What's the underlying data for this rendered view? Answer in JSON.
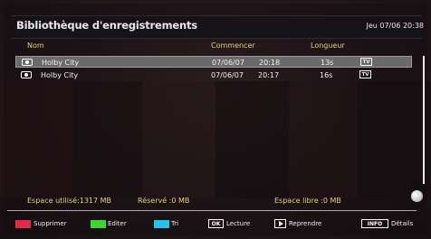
{
  "header": {
    "title": "Bibliothèque d'enregistrements",
    "datetime": "Jeu 07/06 20:38"
  },
  "columns": {
    "name": "Nom",
    "start": "Commencer",
    "length": "Longueur"
  },
  "recordings": [
    {
      "name": "Holby City",
      "date": "07/06/07",
      "time": "20:18",
      "length": "13s",
      "badge": "TV",
      "selected": true
    },
    {
      "name": "Holby City",
      "date": "07/06/07",
      "time": "20:17",
      "length": "16s",
      "badge": "TV",
      "selected": false
    }
  ],
  "storage": {
    "used": "Espace utilisé:1317 MB",
    "reserved": "Réservé :0 MB",
    "free": "Espace libre :0 MB"
  },
  "footer": {
    "delete_label": "Supprimer",
    "edit_label": "Editer",
    "sort_label": "Tri",
    "ok_key": "OK",
    "play_label": "Lecture",
    "resume_label": "Reprendre",
    "info_key": "INFO",
    "details_label": "Détails"
  },
  "colors": {
    "red": "#e02a4a",
    "green": "#3ed62e",
    "blue": "#27c3e6",
    "accent_text": "#e3d080"
  }
}
